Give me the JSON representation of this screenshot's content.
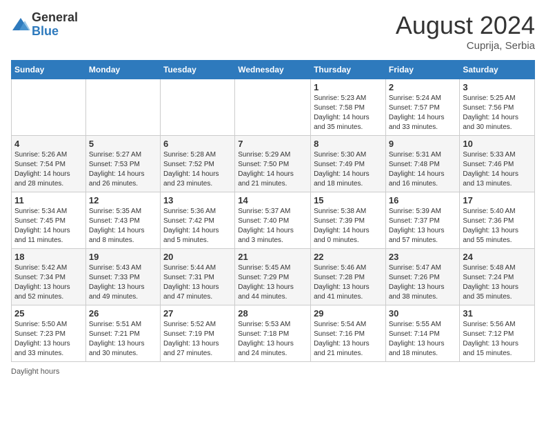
{
  "header": {
    "logo_general": "General",
    "logo_blue": "Blue",
    "month_title": "August 2024",
    "location": "Cuprija, Serbia"
  },
  "footer": {
    "daylight_label": "Daylight hours"
  },
  "weekdays": [
    "Sunday",
    "Monday",
    "Tuesday",
    "Wednesday",
    "Thursday",
    "Friday",
    "Saturday"
  ],
  "weeks": [
    [
      {
        "day": "",
        "info": ""
      },
      {
        "day": "",
        "info": ""
      },
      {
        "day": "",
        "info": ""
      },
      {
        "day": "",
        "info": ""
      },
      {
        "day": "1",
        "info": "Sunrise: 5:23 AM\nSunset: 7:58 PM\nDaylight: 14 hours\nand 35 minutes."
      },
      {
        "day": "2",
        "info": "Sunrise: 5:24 AM\nSunset: 7:57 PM\nDaylight: 14 hours\nand 33 minutes."
      },
      {
        "day": "3",
        "info": "Sunrise: 5:25 AM\nSunset: 7:56 PM\nDaylight: 14 hours\nand 30 minutes."
      }
    ],
    [
      {
        "day": "4",
        "info": "Sunrise: 5:26 AM\nSunset: 7:54 PM\nDaylight: 14 hours\nand 28 minutes."
      },
      {
        "day": "5",
        "info": "Sunrise: 5:27 AM\nSunset: 7:53 PM\nDaylight: 14 hours\nand 26 minutes."
      },
      {
        "day": "6",
        "info": "Sunrise: 5:28 AM\nSunset: 7:52 PM\nDaylight: 14 hours\nand 23 minutes."
      },
      {
        "day": "7",
        "info": "Sunrise: 5:29 AM\nSunset: 7:50 PM\nDaylight: 14 hours\nand 21 minutes."
      },
      {
        "day": "8",
        "info": "Sunrise: 5:30 AM\nSunset: 7:49 PM\nDaylight: 14 hours\nand 18 minutes."
      },
      {
        "day": "9",
        "info": "Sunrise: 5:31 AM\nSunset: 7:48 PM\nDaylight: 14 hours\nand 16 minutes."
      },
      {
        "day": "10",
        "info": "Sunrise: 5:33 AM\nSunset: 7:46 PM\nDaylight: 14 hours\nand 13 minutes."
      }
    ],
    [
      {
        "day": "11",
        "info": "Sunrise: 5:34 AM\nSunset: 7:45 PM\nDaylight: 14 hours\nand 11 minutes."
      },
      {
        "day": "12",
        "info": "Sunrise: 5:35 AM\nSunset: 7:43 PM\nDaylight: 14 hours\nand 8 minutes."
      },
      {
        "day": "13",
        "info": "Sunrise: 5:36 AM\nSunset: 7:42 PM\nDaylight: 14 hours\nand 5 minutes."
      },
      {
        "day": "14",
        "info": "Sunrise: 5:37 AM\nSunset: 7:40 PM\nDaylight: 14 hours\nand 3 minutes."
      },
      {
        "day": "15",
        "info": "Sunrise: 5:38 AM\nSunset: 7:39 PM\nDaylight: 14 hours\nand 0 minutes."
      },
      {
        "day": "16",
        "info": "Sunrise: 5:39 AM\nSunset: 7:37 PM\nDaylight: 13 hours\nand 57 minutes."
      },
      {
        "day": "17",
        "info": "Sunrise: 5:40 AM\nSunset: 7:36 PM\nDaylight: 13 hours\nand 55 minutes."
      }
    ],
    [
      {
        "day": "18",
        "info": "Sunrise: 5:42 AM\nSunset: 7:34 PM\nDaylight: 13 hours\nand 52 minutes."
      },
      {
        "day": "19",
        "info": "Sunrise: 5:43 AM\nSunset: 7:33 PM\nDaylight: 13 hours\nand 49 minutes."
      },
      {
        "day": "20",
        "info": "Sunrise: 5:44 AM\nSunset: 7:31 PM\nDaylight: 13 hours\nand 47 minutes."
      },
      {
        "day": "21",
        "info": "Sunrise: 5:45 AM\nSunset: 7:29 PM\nDaylight: 13 hours\nand 44 minutes."
      },
      {
        "day": "22",
        "info": "Sunrise: 5:46 AM\nSunset: 7:28 PM\nDaylight: 13 hours\nand 41 minutes."
      },
      {
        "day": "23",
        "info": "Sunrise: 5:47 AM\nSunset: 7:26 PM\nDaylight: 13 hours\nand 38 minutes."
      },
      {
        "day": "24",
        "info": "Sunrise: 5:48 AM\nSunset: 7:24 PM\nDaylight: 13 hours\nand 35 minutes."
      }
    ],
    [
      {
        "day": "25",
        "info": "Sunrise: 5:50 AM\nSunset: 7:23 PM\nDaylight: 13 hours\nand 33 minutes."
      },
      {
        "day": "26",
        "info": "Sunrise: 5:51 AM\nSunset: 7:21 PM\nDaylight: 13 hours\nand 30 minutes."
      },
      {
        "day": "27",
        "info": "Sunrise: 5:52 AM\nSunset: 7:19 PM\nDaylight: 13 hours\nand 27 minutes."
      },
      {
        "day": "28",
        "info": "Sunrise: 5:53 AM\nSunset: 7:18 PM\nDaylight: 13 hours\nand 24 minutes."
      },
      {
        "day": "29",
        "info": "Sunrise: 5:54 AM\nSunset: 7:16 PM\nDaylight: 13 hours\nand 21 minutes."
      },
      {
        "day": "30",
        "info": "Sunrise: 5:55 AM\nSunset: 7:14 PM\nDaylight: 13 hours\nand 18 minutes."
      },
      {
        "day": "31",
        "info": "Sunrise: 5:56 AM\nSunset: 7:12 PM\nDaylight: 13 hours\nand 15 minutes."
      }
    ]
  ]
}
